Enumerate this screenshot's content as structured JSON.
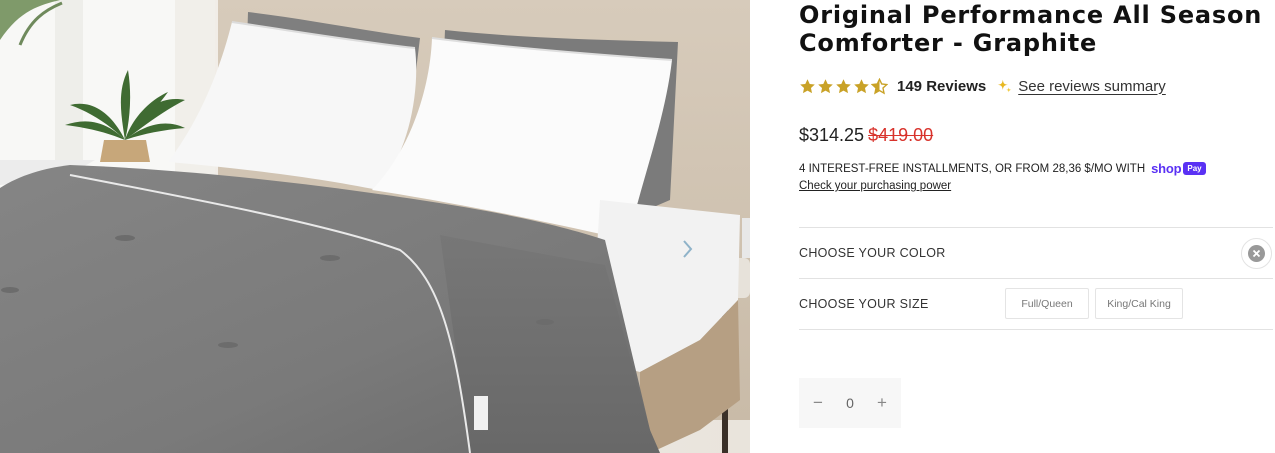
{
  "product": {
    "title": "Original Performance All Season Comforter - Graphite",
    "rating": 4.5,
    "rating_max": 5,
    "reviews_label": "149 Reviews",
    "summary_link": "See reviews summary",
    "price": "$314.25",
    "compare_price": "$419.00"
  },
  "installments": {
    "text": "4 INTEREST-FREE INSTALLMENTS, OR FROM 28,36 $/MO WITH",
    "shop_word": "shop",
    "pay_badge": "Pay",
    "link": "Check your purchasing power"
  },
  "options": {
    "color_label": "CHOOSE YOUR COLOR",
    "size_label": "CHOOSE YOUR SIZE",
    "sizes": [
      "Full/Queen",
      "King/Cal King"
    ]
  },
  "quantity": {
    "minus": "−",
    "value": "0",
    "plus": "+"
  },
  "colors": {
    "star": "#c9a227",
    "shop_purple": "#5a31f4",
    "sale_red": "#d8322b",
    "comforter_gray": "#7b7b7b"
  },
  "icons": {
    "rating": "star-icon",
    "summary": "sparkle-icon",
    "clear": "clear-x-icon",
    "gallery_next": "chevron-right-icon"
  }
}
